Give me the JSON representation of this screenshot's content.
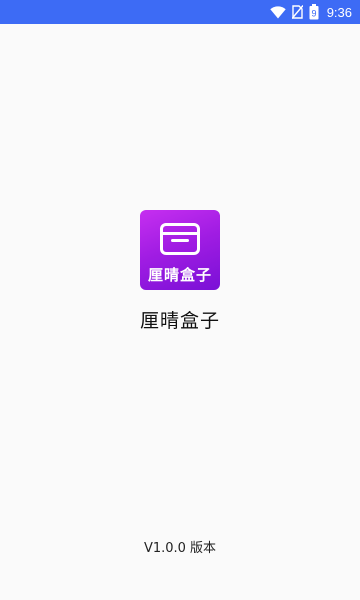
{
  "status_bar": {
    "time": "9:36",
    "battery_level": "9",
    "icons": [
      "wifi-icon",
      "no-sim-icon",
      "battery-icon"
    ],
    "background_color": "#3d6bf5"
  },
  "splash": {
    "logo_text": "厘晴盒子",
    "app_name": "厘晴盒子",
    "version": "V1.0.0 版本",
    "logo_gradient": [
      "#c62ff0",
      "#7a10d6"
    ]
  }
}
